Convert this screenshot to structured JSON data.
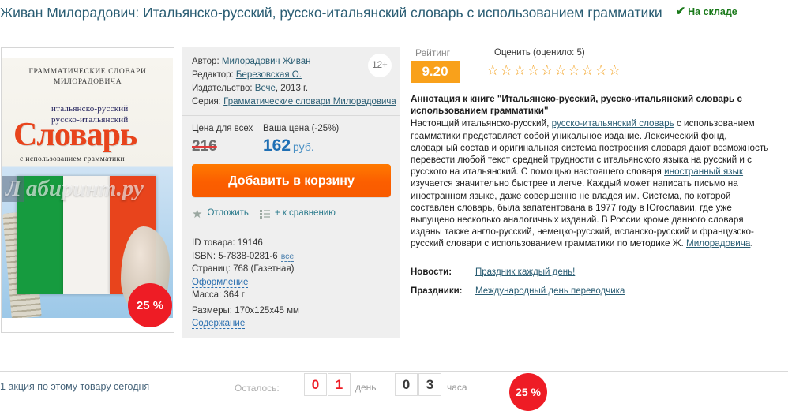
{
  "page": {
    "title": "Живан Милорадович: Итальянско-русский, русско-итальянский словарь с использованием грамматики",
    "stock_status": "На складе",
    "stock_check_icon": "check-icon"
  },
  "cover": {
    "series_line": "ГРАММАТИЧЕСКИЕ СЛОВАРИ МИЛОРАДОВИЧА",
    "subtitle_line1": "итальянско-русский",
    "subtitle_line2": "русско-итальянский",
    "main_word": "Словарь",
    "bottom_line": "с использованием  грамматики",
    "watermark_badge": "Л",
    "watermark_text": "абиринт.ру",
    "discount_badge": "25 %"
  },
  "details": {
    "age_rating": "12+",
    "rows": [
      {
        "label": "Автор:",
        "value": "Милорадович Живан",
        "is_link": true
      },
      {
        "label": "Редактор:",
        "value": "Березовская О.",
        "is_link": true
      },
      {
        "label": "Издательство:",
        "value": "Вече",
        "suffix": ", 2013 г.",
        "is_link": true
      },
      {
        "label": "Серия:",
        "value": "Грамматические словари Милорадовича",
        "is_link": true
      }
    ]
  },
  "price": {
    "all_label": "Цена для всех",
    "your_label": "Ваша цена (-25%)",
    "old_value": "216",
    "new_value": "162",
    "currency": "руб.",
    "cart_button": "Добавить в корзину"
  },
  "actions": {
    "defer_label": "Отложить",
    "defer_icon": "star-icon",
    "compare_label": "+ к сравнению",
    "compare_icon": "list-icon"
  },
  "specs": {
    "id_label": "ID товара:",
    "id_value": "19146",
    "isbn_label": "ISBN:",
    "isbn_value": "5-7838-0281-6",
    "isbn_all_link": "все",
    "pages_label": "Страниц:",
    "pages_value": "768 (Газетная)",
    "design_link": "Оформление",
    "mass_label": "Масса:",
    "mass_value": "364 г",
    "size_label": "Размеры:",
    "size_value": "170x125x45 мм",
    "contents_link": "Содержание"
  },
  "rating": {
    "label": "Рейтинг",
    "value": "9.20",
    "rate_label": "Оценить (оценило: 5)",
    "stars_count": 10,
    "star_glyph": "☆",
    "accent_color": "#f9a11b"
  },
  "annotation": {
    "heading": "Аннотация к книге \"Итальянско-русский, русско-итальянский словарь с использованием грамматики\"",
    "part1": "Настоящий итальянско-русский, ",
    "link1": "русско-итальянский словарь",
    "part2": " с использованием грамматики представляет собой уникальное издание. Лексический фонд, словарный состав и оригинальная система построения словаря дают возможность перевести любой текст средней трудности с итальянского языка на русский и с русского на итальянский. С помощью настоящего словаря ",
    "link2": "иностранный язык",
    "part3": " изучается значительно быстрее и легче. Каждый может написать письмо на иностранном языке, даже совершенно не владея им. Система, по которой составлен словарь, была запатентована в 1977 году в Югославии, где уже выпущено несколько аналогичных изданий. В России кроме данного словаря изданы также англо-русский, немецко-русский, испанско-русский и французско-русский словари с использованием грамматики по методике Ж. ",
    "link3": "Милорадовича",
    "part4": "."
  },
  "news": {
    "news_label": "Новости:",
    "news_link": "Праздник каждый день!",
    "holidays_label": "Праздники:",
    "holidays_link": "Международный день переводчика"
  },
  "promo": {
    "text": "1 акция по этому товару сегодня",
    "remaining_label": "Осталось:",
    "days": [
      "0",
      "1"
    ],
    "days_unit": "день",
    "hours": [
      "0",
      "3"
    ],
    "hours_unit": "часа",
    "badge": "25 %"
  }
}
